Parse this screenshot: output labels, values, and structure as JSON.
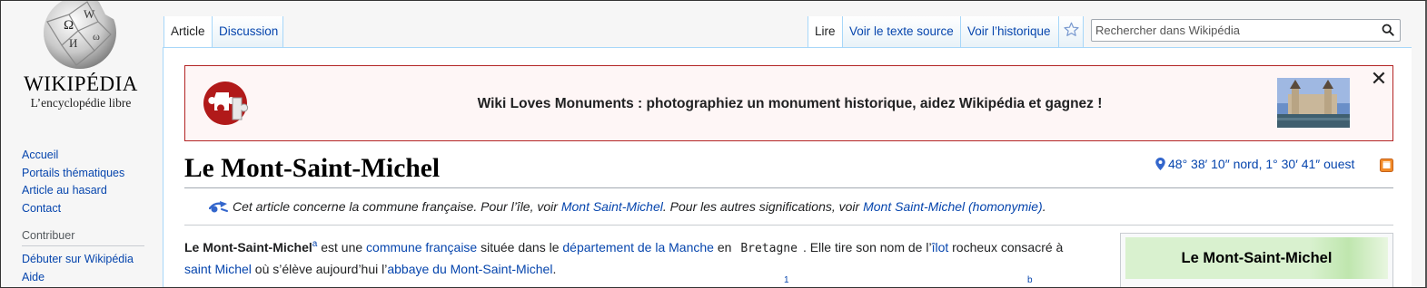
{
  "logo": {
    "wordmark": "Wikipédia",
    "tagline": "L’encyclopédie libre"
  },
  "sidebar": {
    "nav": [
      "Accueil",
      "Portails thématiques",
      "Article au hasard",
      "Contact"
    ],
    "contribute_heading": "Contribuer",
    "contribute": [
      "Débuter sur Wikipédia",
      "Aide"
    ]
  },
  "tabs": {
    "article": "Article",
    "discussion": "Discussion",
    "read": "Lire",
    "source": "Voir le texte source",
    "history": "Voir l’historique"
  },
  "search": {
    "placeholder": "Rechercher dans Wikipédia"
  },
  "banner": {
    "text": "Wiki Loves Monuments : photographiez un monument historique, aidez Wikipédia et gagnez !",
    "close": "✕"
  },
  "article": {
    "title": "Le Mont-Saint-Michel",
    "coordinates": "48° 38′ 10″ nord, 1° 30′ 41″ ouest",
    "hatnote": {
      "t1": "Cet article concerne la commune française. Pour l’île, voir ",
      "link1": "Mont Saint-Michel",
      "t2": ". Pour les autres significations, voir ",
      "link2": "Mont Saint-Michel (homonymie)",
      "t3": "."
    },
    "para": {
      "bold": "Le Mont-Saint-Michel",
      "sup_a": "a",
      "t1": " est une ",
      "link1": "commune française",
      "t2": " située dans le ",
      "link2": "département de la Manche",
      "t3": " en ",
      "code": "Bretagne",
      "t4": ". Elle tire son nom de l’",
      "link3": "îlot",
      "t5": " rocheux consacré à",
      "link4": "saint Michel",
      "t6": " où s’élève aujourd’hui l’",
      "link5": "abbaye du Mont-Saint-Michel",
      "t7": "."
    },
    "para2_sup1": "1",
    "para2_sup2": "b"
  },
  "infobox": {
    "title": "Le Mont-Saint-Michel"
  },
  "colors": {
    "link": "#0645ad",
    "banner_border": "#b32424",
    "tab_border": "#a7d7f9"
  }
}
